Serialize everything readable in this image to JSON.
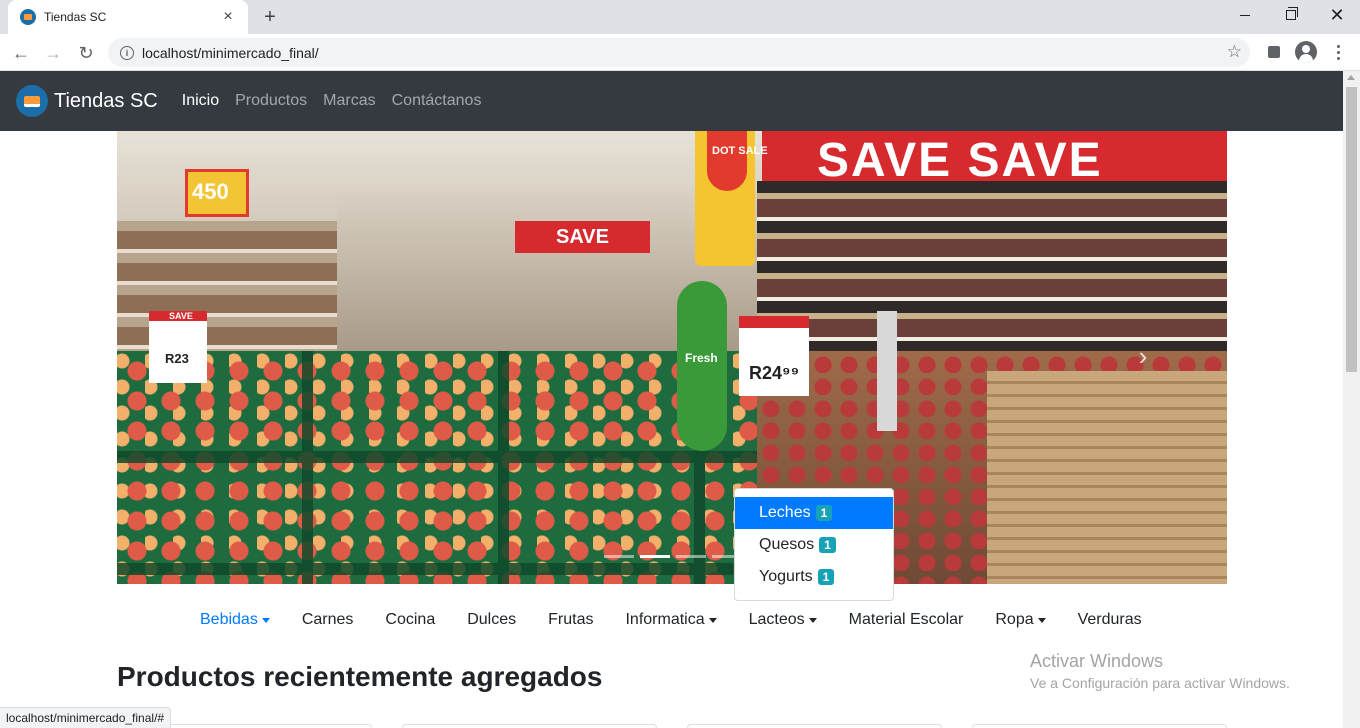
{
  "browser": {
    "tab_title": "Tiendas SC",
    "url": "localhost/minimercado_final/",
    "status_url": "localhost/minimercado_final/#"
  },
  "navbar": {
    "brand": "Tiendas SC",
    "links": [
      "Inicio",
      "Productos",
      "Marcas",
      "Contáctanos"
    ],
    "active": "Inicio"
  },
  "carousel": {
    "indicator_count": 4,
    "active_index": 1,
    "signs": {
      "banner": "SAVE SAVE",
      "save_center": "SAVE",
      "save_small": "SAVE",
      "price_big": "450",
      "price_left": "R23",
      "price_right": "R24⁹⁹",
      "dot_sale": "DOT SALE",
      "fresh": "Fresh"
    }
  },
  "dropdown": {
    "items": [
      {
        "label": "Leches",
        "count": "1",
        "active": true
      },
      {
        "label": "Quesos",
        "count": "1",
        "active": false
      },
      {
        "label": "Yogurts",
        "count": "1",
        "active": false
      }
    ]
  },
  "categories": [
    {
      "label": "Bebidas",
      "dropdown": true,
      "active": true
    },
    {
      "label": "Carnes",
      "dropdown": false,
      "active": false
    },
    {
      "label": "Cocina",
      "dropdown": false,
      "active": false
    },
    {
      "label": "Dulces",
      "dropdown": false,
      "active": false
    },
    {
      "label": "Frutas",
      "dropdown": false,
      "active": false
    },
    {
      "label": "Informatica",
      "dropdown": true,
      "active": false
    },
    {
      "label": "Lacteos",
      "dropdown": true,
      "active": false
    },
    {
      "label": "Material Escolar",
      "dropdown": false,
      "active": false
    },
    {
      "label": "Ropa",
      "dropdown": true,
      "active": false
    },
    {
      "label": "Verduras",
      "dropdown": false,
      "active": false
    }
  ],
  "section_title": "Productos recientemente agregados",
  "watermark": {
    "line1": "Activar Windows",
    "line2": "Ve a Configuración para activar Windows."
  },
  "colors": {
    "navbar_bg": "#343a40",
    "link_active": "#007bff",
    "badge": "#17a2b8"
  }
}
